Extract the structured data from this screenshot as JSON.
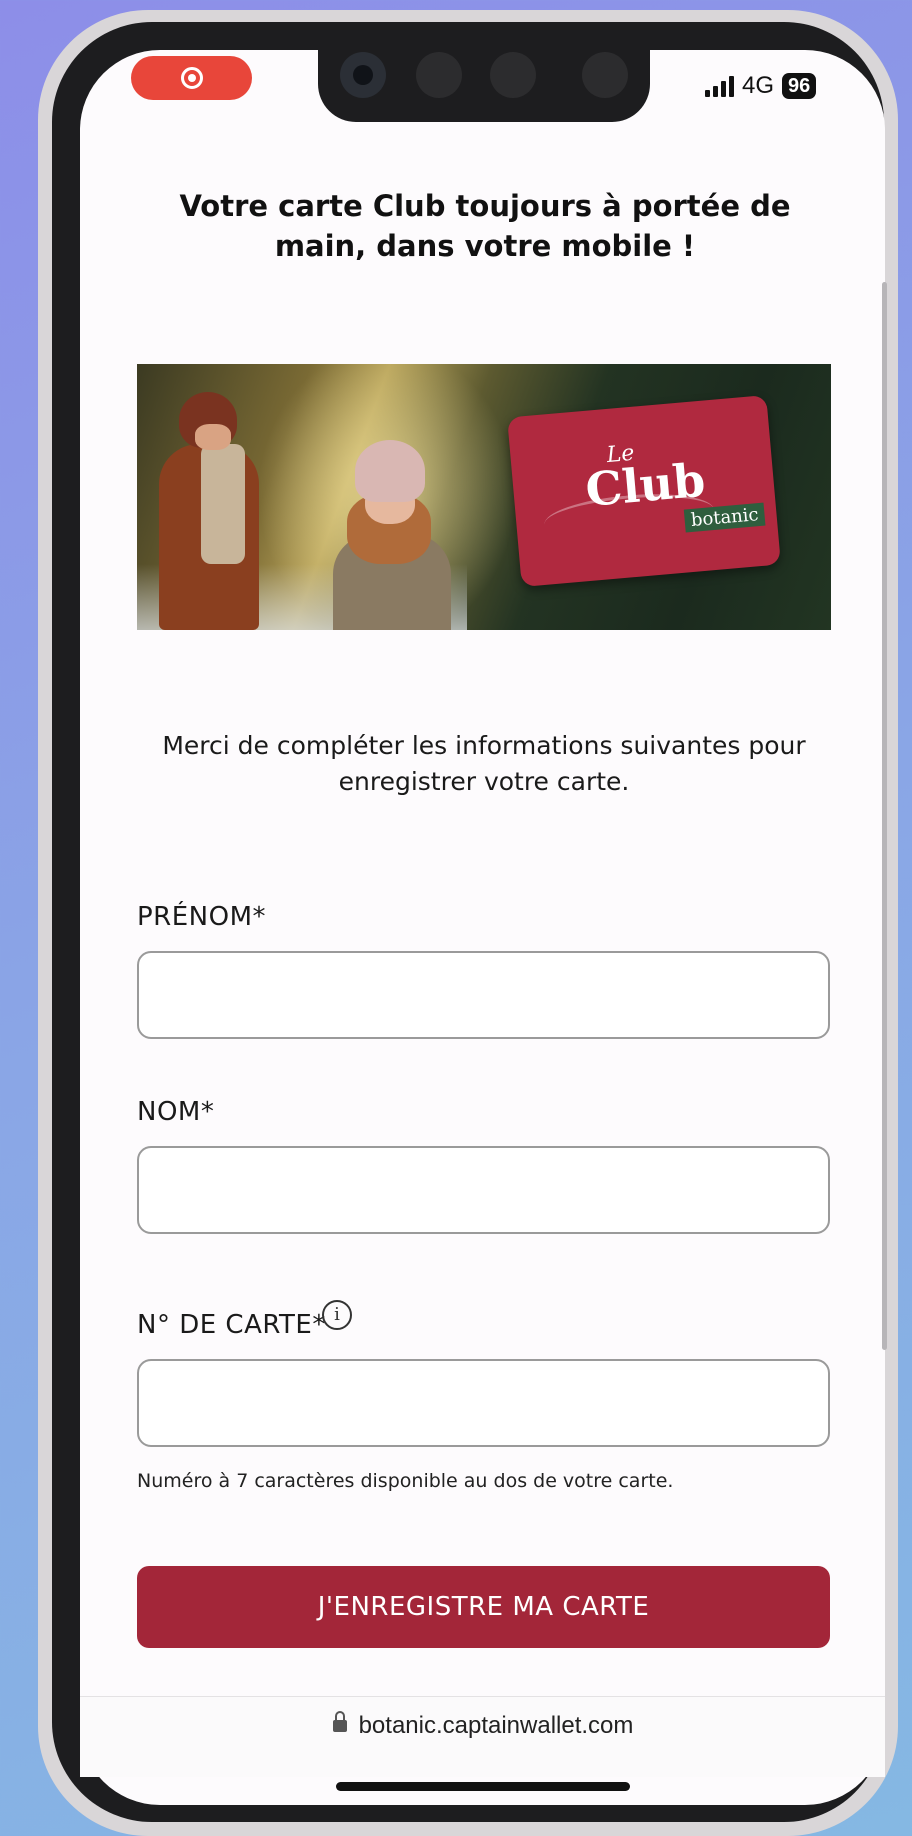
{
  "status_bar": {
    "signal": "4G",
    "battery": "96"
  },
  "page": {
    "headline": "Votre carte Club toujours à portée de main, dans votre mobile !",
    "banner": {
      "card_le": "Le",
      "card_title": "Club",
      "card_brand": "botanic"
    },
    "intro": "Merci de compléter les informations suivantes pour enregistrer votre carte."
  },
  "form": {
    "first_name_label": "PRÉNOM*",
    "first_name_value": "",
    "last_name_label": "NOM*",
    "last_name_value": "",
    "card_number_label": "N° DE CARTE*",
    "card_number_value": "",
    "card_number_hint": "Numéro à 7 caractères disponible au dos de votre carte.",
    "info_glyph": "i",
    "submit_label": "J'ENREGISTRE MA CARTE"
  },
  "browser": {
    "url": "botanic.captainwallet.com"
  },
  "colors": {
    "accent": "#a32639",
    "card": "#b0293f",
    "record_indicator": "#e8463a"
  }
}
